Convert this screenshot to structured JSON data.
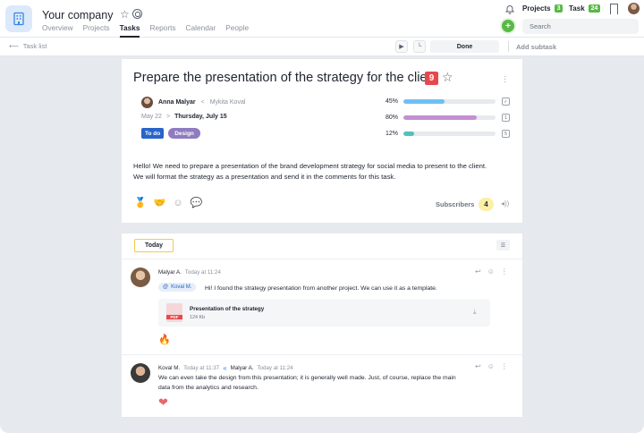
{
  "header": {
    "company": "Your company",
    "nav": [
      "Overview",
      "Projects",
      "Tasks",
      "Reports",
      "Calendar",
      "People"
    ],
    "active_nav": "Tasks",
    "projects_label": "Projects",
    "projects_count": "3",
    "task_label": "Task",
    "task_count": "24",
    "search_placeholder": "Search"
  },
  "subbar": {
    "back_label": "Task list",
    "status_label": "Done",
    "add_subtask": "Add subtask"
  },
  "task": {
    "title": "Prepare the presentation of the strategy for the client",
    "priority": "9",
    "assignee": "Anna Malyar",
    "assignee_arrow": "<",
    "reviewer": "Mykita Koval",
    "start_date": "May 22",
    "date_arrow": ">",
    "due_date": "Thursday, July 15",
    "tag_status": "To do",
    "tag_label": "Design",
    "progress": [
      {
        "label": "45%",
        "value": 45,
        "color": "#6ec0f3",
        "icon": "✓"
      },
      {
        "label": "80%",
        "value": 80,
        "color": "#c58fd3",
        "icon": "1"
      },
      {
        "label": "12%",
        "value": 12,
        "color": "#4fc2bd",
        "icon": "5"
      }
    ],
    "description": "Hello! We need to prepare a presentation of the brand development strategy for social media to present to the client. We will format the strategy as a presentation and send it in the comments for this task.",
    "subscribers_label": "Subscribers",
    "subscribers_count": "4"
  },
  "comments": {
    "date_filter": "Today",
    "items": [
      {
        "author": "Malyar A.",
        "time": "Today at 11:24",
        "mention": "Koval M.",
        "text": "Hi! I found the strategy presentation from another project. We can use it as a template.",
        "file_name": "Presentation of the strategy",
        "file_size": "124 Kb",
        "file_type": "PDF",
        "reaction": "🔥"
      },
      {
        "author": "Koval M.",
        "time": "Today at 11:37",
        "reply_to": "Malyar A.",
        "reply_time": "Today at 11:24",
        "text": "We can even take the design from this presentation; it is generally well made. Just, of course, replace the main data from the analytics and research.",
        "reaction": "❤"
      }
    ]
  }
}
